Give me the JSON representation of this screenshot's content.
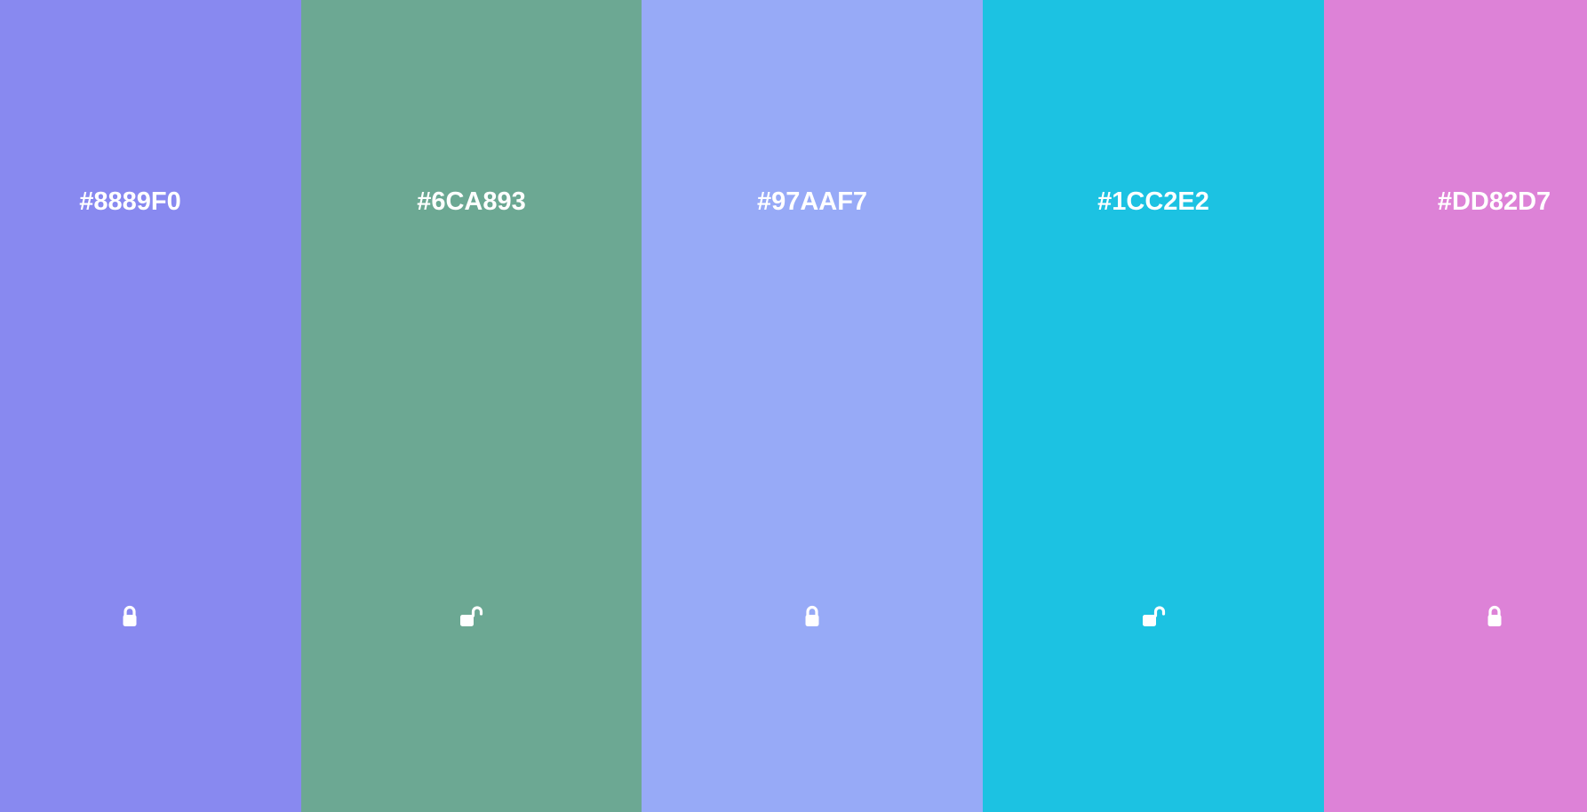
{
  "swatches": [
    {
      "hex": "#8889F0",
      "color": "#8889F0",
      "lock_state": "locked",
      "icon": "lock-icon"
    },
    {
      "hex": "#6CA893",
      "color": "#6CA893",
      "lock_state": "unlocked",
      "icon": "unlock-icon"
    },
    {
      "hex": "#97AAF7",
      "color": "#97AAF7",
      "lock_state": "locked",
      "icon": "lock-icon"
    },
    {
      "hex": "#1CC2E2",
      "color": "#1CC2E2",
      "lock_state": "unlocked",
      "icon": "unlock-icon"
    },
    {
      "hex": "#DD82D7",
      "color": "#DD82D7",
      "lock_state": "locked",
      "icon": "lock-icon"
    }
  ],
  "label_color": "#FFFFFF"
}
